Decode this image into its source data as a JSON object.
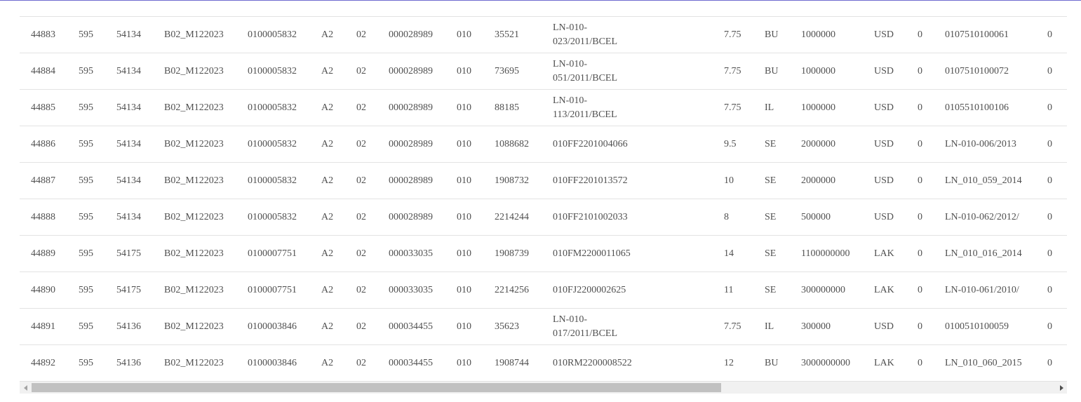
{
  "table": {
    "rows": [
      [
        "44883",
        "595",
        "54134",
        "B02_M122023",
        "0100005832",
        "A2",
        "02",
        "000028989",
        "010",
        "35521",
        "LN-010-023/2011/BCEL",
        "7.75",
        "BU",
        "1000000",
        "USD",
        "0",
        "0107510100061",
        "0"
      ],
      [
        "44884",
        "595",
        "54134",
        "B02_M122023",
        "0100005832",
        "A2",
        "02",
        "000028989",
        "010",
        "73695",
        "LN-010-051/2011/BCEL",
        "7.75",
        "BU",
        "1000000",
        "USD",
        "0",
        "0107510100072",
        "0"
      ],
      [
        "44885",
        "595",
        "54134",
        "B02_M122023",
        "0100005832",
        "A2",
        "02",
        "000028989",
        "010",
        "88185",
        "LN-010-113/2011/BCEL",
        "7.75",
        "IL",
        "1000000",
        "USD",
        "0",
        "0105510100106",
        "0"
      ],
      [
        "44886",
        "595",
        "54134",
        "B02_M122023",
        "0100005832",
        "A2",
        "02",
        "000028989",
        "010",
        "1088682",
        "010FF2201004066",
        "9.5",
        "SE",
        "2000000",
        "USD",
        "0",
        "LN-010-006/2013",
        "0"
      ],
      [
        "44887",
        "595",
        "54134",
        "B02_M122023",
        "0100005832",
        "A2",
        "02",
        "000028989",
        "010",
        "1908732",
        "010FF2201013572",
        "10",
        "SE",
        "2000000",
        "USD",
        "0",
        "LN_010_059_2014",
        "0"
      ],
      [
        "44888",
        "595",
        "54134",
        "B02_M122023",
        "0100005832",
        "A2",
        "02",
        "000028989",
        "010",
        "2214244",
        "010FF2101002033",
        "8",
        "SE",
        "500000",
        "USD",
        "0",
        "LN-010-062/2012/",
        "0"
      ],
      [
        "44889",
        "595",
        "54175",
        "B02_M122023",
        "0100007751",
        "A2",
        "02",
        "000033035",
        "010",
        "1908739",
        "010FM2200011065",
        "14",
        "SE",
        "1100000000",
        "LAK",
        "0",
        "LN_010_016_2014",
        "0"
      ],
      [
        "44890",
        "595",
        "54175",
        "B02_M122023",
        "0100007751",
        "A2",
        "02",
        "000033035",
        "010",
        "2214256",
        "010FJ2200002625",
        "11",
        "SE",
        "300000000",
        "LAK",
        "0",
        "LN-010-061/2010/",
        "0"
      ],
      [
        "44891",
        "595",
        "54136",
        "B02_M122023",
        "0100003846",
        "A2",
        "02",
        "000034455",
        "010",
        "35623",
        "LN-010-017/2011/BCEL",
        "7.75",
        "IL",
        "300000",
        "USD",
        "0",
        "0100510100059",
        "0"
      ],
      [
        "44892",
        "595",
        "54136",
        "B02_M122023",
        "0100003846",
        "A2",
        "02",
        "000034455",
        "010",
        "1908744",
        "010RM2200008522",
        "12",
        "BU",
        "3000000000",
        "LAK",
        "0",
        "LN_010_060_2015",
        "0"
      ]
    ]
  },
  "scrollbar": {
    "left_arrow_icon": "chevron-left-icon",
    "right_arrow_icon": "chevron-right-icon"
  }
}
